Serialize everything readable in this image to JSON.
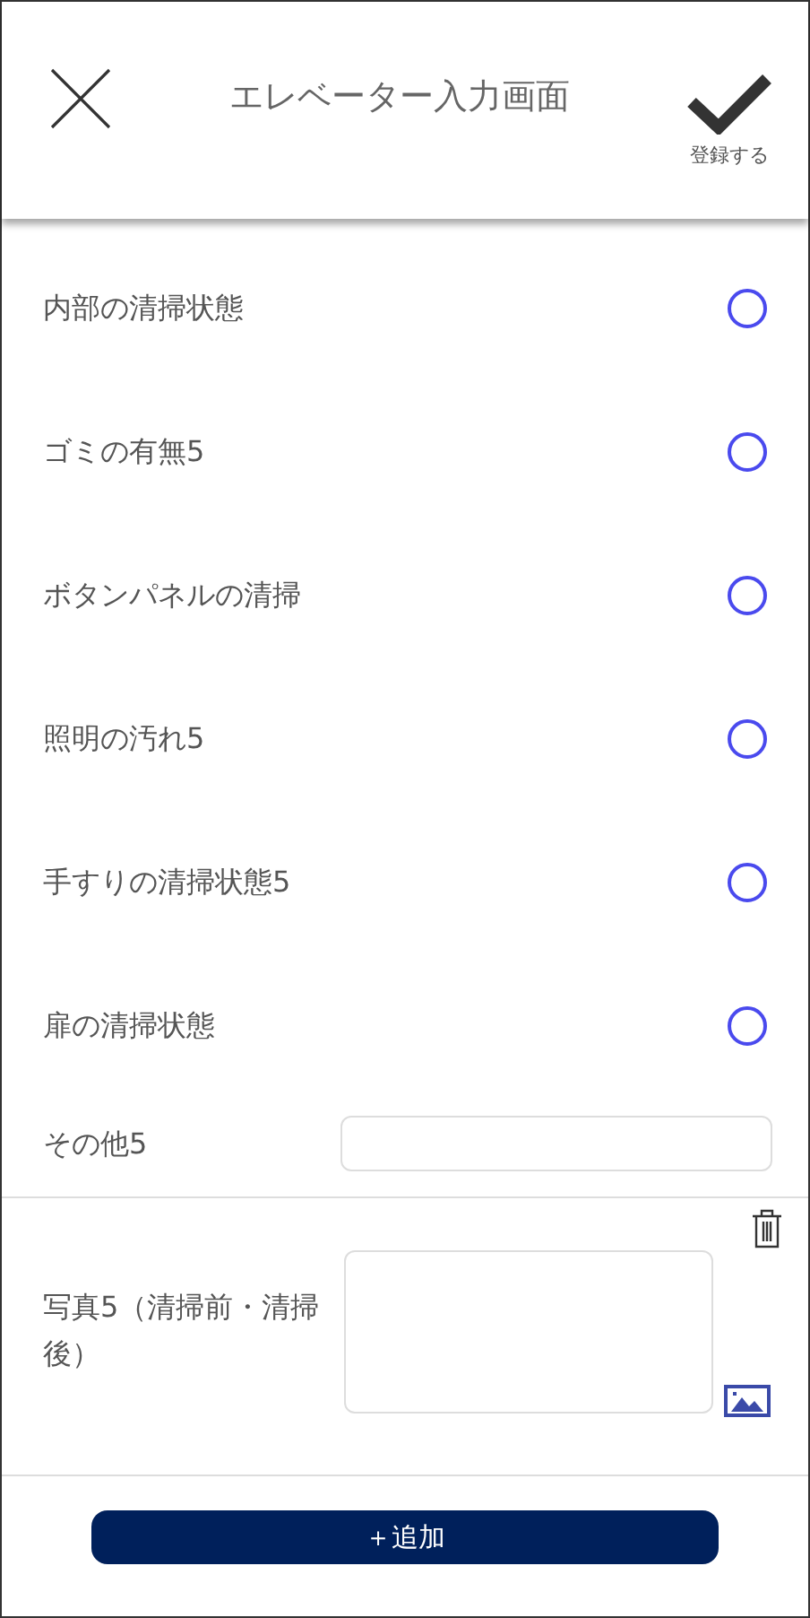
{
  "header": {
    "title": "エレベーター入力画面",
    "confirm_label": "登録する"
  },
  "checks": [
    {
      "label": "内部の清掃状態",
      "checked": false
    },
    {
      "label": "ゴミの有無5",
      "checked": false
    },
    {
      "label": "ボタンパネルの清掃",
      "checked": false
    },
    {
      "label": "照明の汚れ5",
      "checked": false
    },
    {
      "label": "手すりの清掃状態5",
      "checked": false
    },
    {
      "label": "扉の清掃状態",
      "checked": false
    }
  ],
  "other": {
    "label": "その他5"
  },
  "photo": {
    "label": "写真5（清掃前・清掃後）"
  },
  "add_button": "＋追加"
}
